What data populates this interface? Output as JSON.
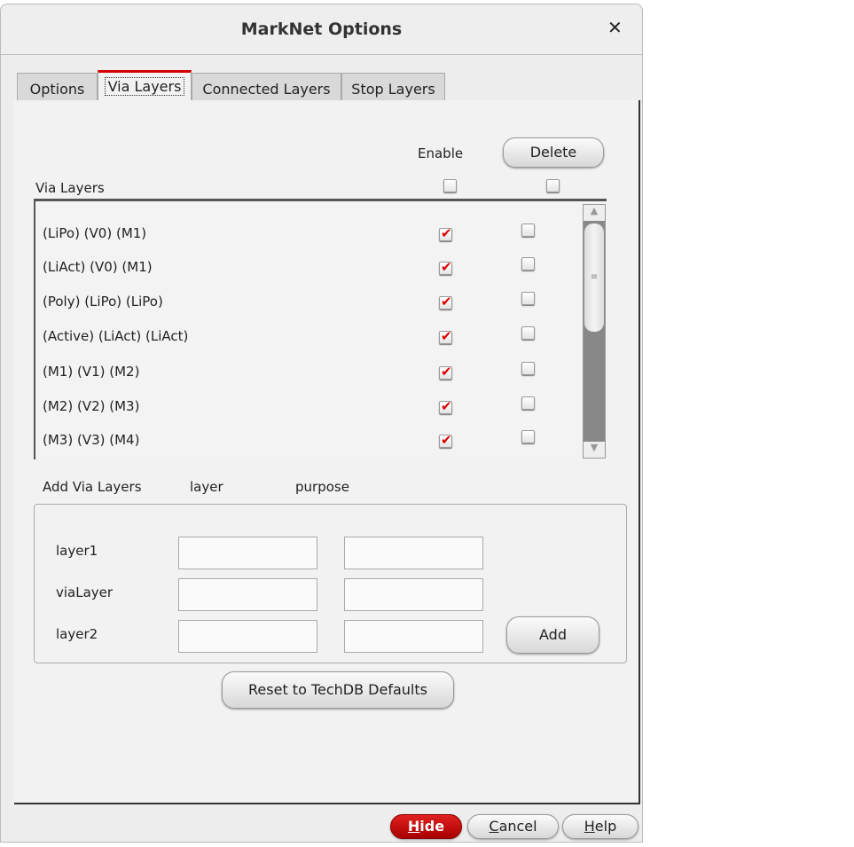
{
  "window": {
    "title": "MarkNet Options",
    "close_icon": "close-icon"
  },
  "tabs": [
    {
      "label": "Options"
    },
    {
      "label": "Via Layers",
      "active": true
    },
    {
      "label": "Connected Layers"
    },
    {
      "label": "Stop Layers"
    }
  ],
  "via": {
    "enable_label": "Enable",
    "delete_label": "Delete",
    "list_label": "Via Layers",
    "enable_all": false,
    "delete_all": false,
    "rows": [
      {
        "label": "(LiPo)  (V0)  (M1)",
        "enable": true,
        "delete": false
      },
      {
        "label": "(LiAct)  (V0)  (M1)",
        "enable": true,
        "delete": false
      },
      {
        "label": "(Poly)  (LiPo)  (LiPo)",
        "enable": true,
        "delete": false
      },
      {
        "label": "(Active)  (LiAct)  (LiAct)",
        "enable": true,
        "delete": false
      },
      {
        "label": "(M1)  (V1)  (M2)",
        "enable": true,
        "delete": false
      },
      {
        "label": "(M2)  (V2)  (M3)",
        "enable": true,
        "delete": false
      },
      {
        "label": "(M3)  (V3)  (M4)",
        "enable": true,
        "delete": false
      }
    ]
  },
  "add": {
    "title": "Add Via Layers",
    "col_layer": "layer",
    "col_purpose": "purpose",
    "rows": [
      {
        "label": "layer1",
        "layer": "",
        "purpose": ""
      },
      {
        "label": "viaLayer",
        "layer": "",
        "purpose": ""
      },
      {
        "label": "layer2",
        "layer": "",
        "purpose": ""
      }
    ],
    "add_label": "Add"
  },
  "reset_label": "Reset to TechDB Defaults",
  "footer": {
    "hide_m": "H",
    "hide_rest": "ide",
    "cancel_m": "C",
    "cancel_rest": "ancel",
    "help_m": "H",
    "help_rest": "elp"
  },
  "colors": {
    "accent": "#c80000"
  }
}
